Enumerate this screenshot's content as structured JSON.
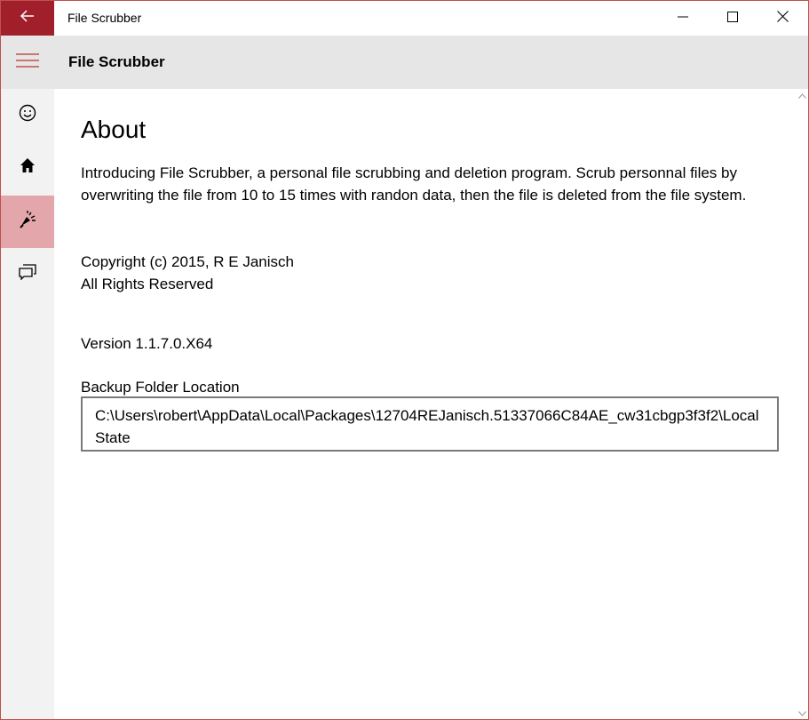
{
  "window": {
    "title": "File Scrubber",
    "accent_color": "#a11f2b",
    "selected_nav_color": "#e3a6aa"
  },
  "titlebar": {
    "back_icon": "back-arrow-icon",
    "controls": [
      "minimize-icon",
      "maximize-icon",
      "close-icon"
    ]
  },
  "header": {
    "menu_icon": "hamburger-icon",
    "title": "File Scrubber"
  },
  "nav": {
    "items": [
      {
        "icon": "smiley-icon",
        "selected": false
      },
      {
        "icon": "home-icon",
        "selected": false
      },
      {
        "icon": "shred-icon",
        "selected": true
      },
      {
        "icon": "chat-icon",
        "selected": false
      }
    ]
  },
  "about": {
    "title": "About",
    "intro": "Introducing File Scrubber, a personal file scrubbing and deletion program.  Scrub personnal files by overwriting the file from 10 to 15 times with randon data, then the file is deleted from the file system.",
    "copyright": "Copyright (c) 2015, R E Janisch",
    "rights": "All Rights Reserved",
    "version": "Version 1.1.7.0.X64",
    "backup_label": "Backup Folder Location",
    "backup_path": "C:\\Users\\robert\\AppData\\Local\\Packages\\12704REJanisch.51337066C84AE_cw31cbgp3f3f2\\LocalState"
  }
}
